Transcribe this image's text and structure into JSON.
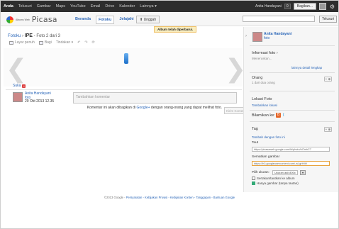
{
  "gbar": {
    "links": [
      "Anda",
      "Telusuri",
      "Gambar",
      "Maps",
      "YouTube",
      "Email",
      "Drive",
      "Kalender",
      "Lainnya ▾"
    ],
    "user_name": "Anita Handayani",
    "share_count": "0",
    "bagikan_label": "Bagikan..."
  },
  "header": {
    "brand_small": "Albums Web",
    "brand": "Picasa",
    "tabs": [
      "Beranda",
      "Fotoku",
      "Jelajahi"
    ],
    "upload_label": "⬆ Unggah",
    "search_button": "Telusuri",
    "notification": "Album telah diperbarui."
  },
  "main": {
    "crumb_root": "Fotoku",
    "crumb_album": "IPE",
    "crumb_pos": "- Foto 2 dari 3",
    "toolbar": {
      "slideshow": "Layar penuh",
      "share": "Bagi",
      "actions": "Tindakan ▾"
    },
    "like_label": "Suka",
    "owner": {
      "name": "Anita Handayani",
      "sub": "foto",
      "date": "29 Okt 2013 12.35"
    },
    "comment_placeholder": "Tambahkan komentar",
    "comment_note_pre": "Komentar ini akan dibagikan di",
    "comment_note_link": "Google+",
    "comment_note_post": "dengan orang-orang yang dapat melihat foto.",
    "comment_button": "Kirim Komentar"
  },
  "sidebar": {
    "owner_name": "Anita Handayani",
    "owner_sub": "foto",
    "info_label": "Informasi foto ›",
    "info_sub": "Meneruskan...",
    "details_link": "lainnya detail lengkap",
    "people_label": "Orang",
    "people_sub": "1 dari dua orang",
    "add_label": "+ ⊕",
    "location_label": "Lokasi Foto",
    "location_link": "Tambahkan lokasi",
    "share_label": "Bilamikan ke:",
    "tags_label": "Tag",
    "tags_link": "Tambah dengan foto ini",
    "link_label": "Taut",
    "link_value": "https://picasaweb.google.com/lh/photo/hi7mhC7",
    "embed_label": "Sematkan gambar",
    "embed_value": "https://lh3.googleusercontent.com/-wLgHHi9",
    "size_label": "Pilih ukuran:",
    "size_value": "Ukuran asli 800x",
    "size_btn": "▾",
    "chk1": "Sertakan/tautkan ke album",
    "chk2": "Hanya gambar (tanpa tautan)"
  },
  "footer": {
    "copyright": "©2013 Google -",
    "links": "Persyaratan - Kebijakan Privasi - Kebijakan Konten - Tanggapan - Bantuan Google"
  }
}
